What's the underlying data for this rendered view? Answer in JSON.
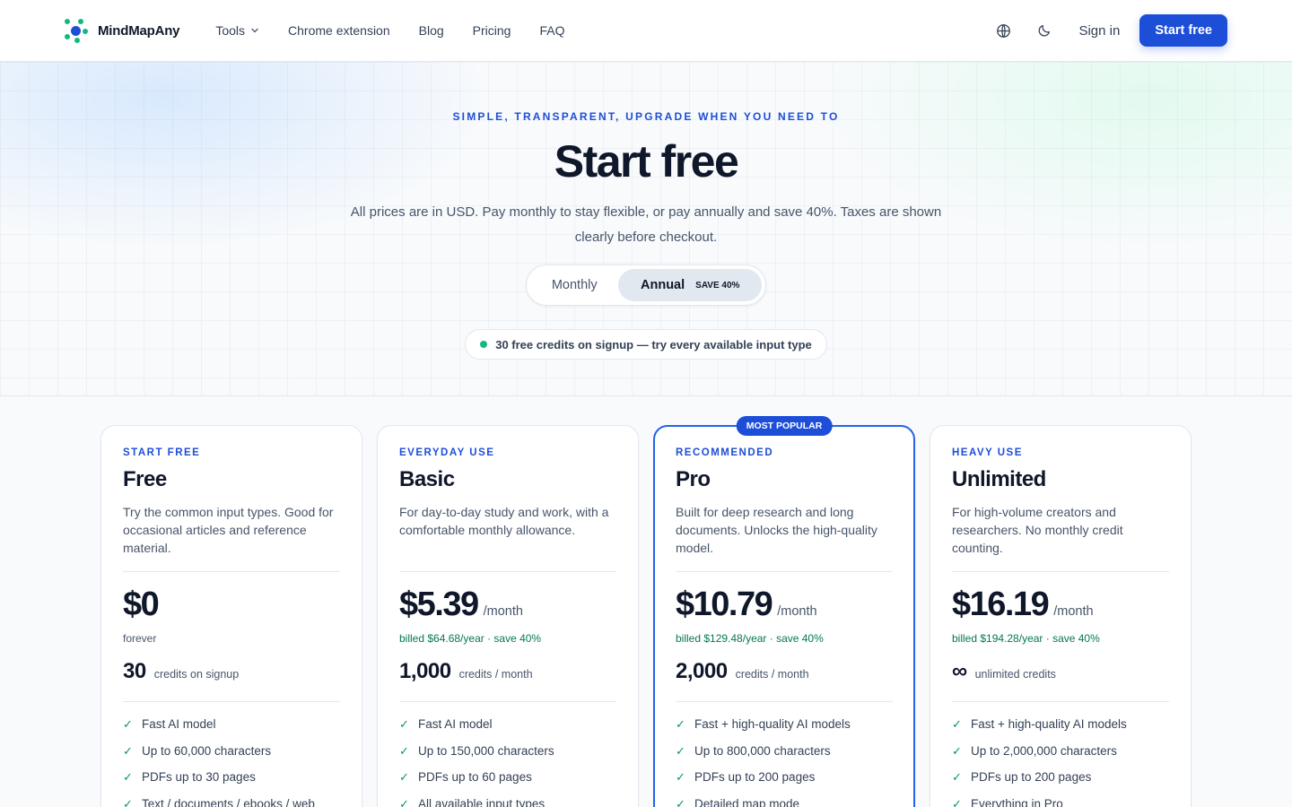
{
  "header": {
    "brand": "MindMapAny",
    "nav": [
      {
        "label": "Tools",
        "dropdown": true
      },
      {
        "label": "Chrome extension"
      },
      {
        "label": "Blog"
      },
      {
        "label": "Pricing"
      },
      {
        "label": "FAQ"
      }
    ],
    "signin": "Sign in",
    "cta": "Start free",
    "icons": [
      "globe-icon",
      "moon-icon",
      "chevron-down-icon"
    ]
  },
  "hero": {
    "eyebrow": "SIMPLE, TRANSPARENT, UPGRADE WHEN YOU NEED TO",
    "title": "Start free",
    "subtitle": "All prices are in USD. Pay monthly to stay flexible, or pay annually and save 40%. Taxes are shown clearly before checkout.",
    "toggle": {
      "monthly": "Monthly",
      "annual": "Annual",
      "save": "SAVE 40%",
      "selected": "Annual"
    },
    "credits_note": "30 free credits on signup — try every available input type"
  },
  "plans": [
    {
      "tag": "START FREE",
      "name": "Free",
      "description": "Try the common input types. Good for occasional articles and reference material.",
      "price": "$0",
      "per": "",
      "billed": "forever",
      "credits": "30",
      "credits_label": "credits on signup",
      "features": [
        "Fast AI model",
        "Up to 60,000 characters",
        "PDFs up to 30 pages",
        "Text / documents / ebooks / web"
      ]
    },
    {
      "tag": "EVERYDAY USE",
      "name": "Basic",
      "description": "For day-to-day study and work, with a comfortable monthly allowance.",
      "price": "$5.39",
      "per": "/month",
      "billed": "billed $64.68/year · save 40%",
      "credits": "1,000",
      "credits_label": "credits / month",
      "features": [
        "Fast AI model",
        "Up to 150,000 characters",
        "PDFs up to 60 pages",
        "All available input types"
      ]
    },
    {
      "tag": "RECOMMENDED",
      "name": "Pro",
      "badge": "MOST POPULAR",
      "description": "Built for deep research and long documents. Unlocks the high-quality model.",
      "price": "$10.79",
      "per": "/month",
      "billed": "billed $129.48/year · save 40%",
      "credits": "2,000",
      "credits_label": "credits / month",
      "features": [
        "Fast + high-quality AI models",
        "Up to 800,000 characters",
        "PDFs up to 200 pages",
        "Detailed map mode"
      ]
    },
    {
      "tag": "HEAVY USE",
      "name": "Unlimited",
      "description": "For high-volume creators and researchers. No monthly credit counting.",
      "price": "$16.19",
      "per": "/month",
      "billed": "billed $194.28/year · save 40%",
      "credits": "∞",
      "credits_label": "unlimited credits",
      "features": [
        "Fast + high-quality AI models",
        "Up to 2,000,000 characters",
        "PDFs up to 200 pages",
        "Everything in Pro"
      ]
    }
  ],
  "colors": {
    "accent": "#1d4ed8",
    "success": "#059669",
    "text": "#0f172a"
  }
}
